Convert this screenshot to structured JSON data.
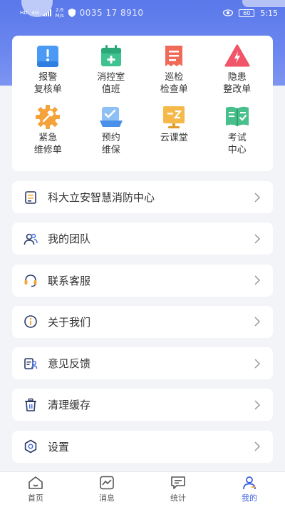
{
  "status_bar": {
    "network_left": "HD",
    "network_type": "4G",
    "speed_value": "2.6",
    "speed_unit": "M/s",
    "phone_masked": "0035 17 8910",
    "battery": "60",
    "time": "5:15"
  },
  "grid": {
    "items": [
      {
        "label": "报警\n复核单",
        "icon": "alarm-review-icon",
        "color": "#4a9af5"
      },
      {
        "label": "消控室\n值班",
        "icon": "control-room-duty-icon",
        "color": "#3ec28f"
      },
      {
        "label": "巡检\n检查单",
        "icon": "inspection-sheet-icon",
        "color": "#f06a5a"
      },
      {
        "label": "隐患\n整改单",
        "icon": "hazard-rectify-icon",
        "color": "#f0556a"
      },
      {
        "label": "紧急\n维修单",
        "icon": "emergency-repair-icon",
        "color": "#f5a23a"
      },
      {
        "label": "预约\n维保",
        "icon": "maintenance-booking-icon",
        "color": "#6aa8f0"
      },
      {
        "label": "云课堂",
        "icon": "cloud-class-icon",
        "color": "#f5b94a"
      },
      {
        "label": "考试\n中心",
        "icon": "exam-center-icon",
        "color": "#49c08c"
      }
    ]
  },
  "menu": {
    "items": [
      {
        "label": "科大立安智慧消防中心",
        "icon": "org-center-icon",
        "color": "#f2a93b"
      },
      {
        "label": "我的团队",
        "icon": "team-icon",
        "color": "#4a72e8"
      },
      {
        "label": "联系客服",
        "icon": "customer-service-icon",
        "color": "#f2a93b"
      },
      {
        "label": "关于我们",
        "icon": "info-icon",
        "color": "#f2a93b"
      },
      {
        "label": "意见反馈",
        "icon": "feedback-icon",
        "color": "#4a72e8"
      },
      {
        "label": "清理缓存",
        "icon": "trash-icon",
        "color": "#4a72e8"
      },
      {
        "label": "设置",
        "icon": "settings-icon",
        "color": "#4a72e8"
      }
    ]
  },
  "tabbar": {
    "tabs": [
      {
        "label": "首页",
        "icon": "home-icon"
      },
      {
        "label": "消息",
        "icon": "message-icon"
      },
      {
        "label": "统计",
        "icon": "statistics-icon"
      },
      {
        "label": "我的",
        "icon": "profile-icon",
        "active": true
      }
    ]
  },
  "colors": {
    "header_gradient_top": "#5a78ea",
    "accent": "#3a5fe0",
    "page_background": "#f3f4f8"
  }
}
